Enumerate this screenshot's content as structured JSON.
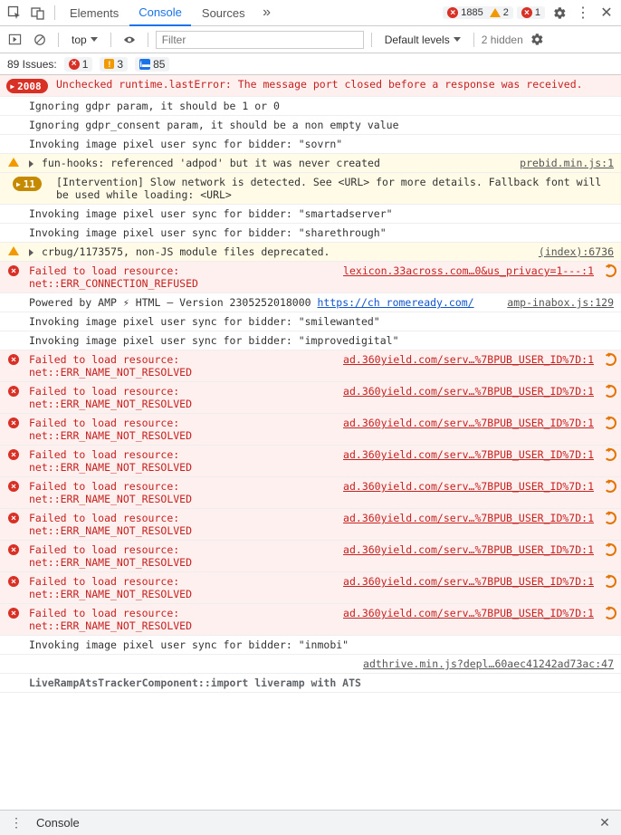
{
  "header": {
    "tabs": [
      "Elements",
      "Console",
      "Sources"
    ],
    "active_tab": 1,
    "error_count": "1885",
    "warn_count": "2",
    "other_err": "1"
  },
  "toolbar": {
    "context": "top",
    "filter_placeholder": "Filter",
    "levels": "Default levels",
    "hidden": "2 hidden"
  },
  "issues": {
    "label": "89 Issues:",
    "red": "1",
    "yellow": "3",
    "blue": "85"
  },
  "rows": [
    {
      "type": "error",
      "badge": "2008",
      "badgeKind": "err",
      "text": "Unchecked runtime.lastError: The message port closed before a response was received.",
      "source": "",
      "reficon": false
    },
    {
      "type": "log",
      "text": "Ignoring gdpr param, it should be 1 or 0"
    },
    {
      "type": "log",
      "text": "Ignoring gdpr_consent param, it should be a non empty value"
    },
    {
      "type": "log",
      "text": "Invoking image pixel user sync for bidder: \"sovrn\""
    },
    {
      "type": "warn",
      "disclose": true,
      "text": "fun-hooks: referenced 'adpod' but it was never created",
      "source": "prebid.min.js:1"
    },
    {
      "type": "warn",
      "badge": "11",
      "badgeKind": "warn",
      "text": "[Intervention] Slow network is detected. See <URL> for more details. Fallback font will be used while loading: <URL>"
    },
    {
      "type": "log",
      "text": "Invoking image pixel user sync for bidder: \"smartadserver\""
    },
    {
      "type": "log",
      "text": "Invoking image pixel user sync for bidder: \"sharethrough\""
    },
    {
      "type": "warn",
      "disclose": true,
      "text": "crbug/1173575, non-JS module files deprecated.",
      "source": "(index):6736"
    },
    {
      "type": "error",
      "icon": "errx",
      "text": "Failed to load resource: net::ERR_CONNECTION_REFUSED",
      "source": "lexicon.33across.com…0&us_privacy=1---:1",
      "reficon": true
    },
    {
      "type": "log",
      "html": true,
      "text": "Powered by AMP ⚡ HTML – Version 2305252018000 ",
      "link1": "https://ch romeready.com/",
      "source": "amp-inabox.js:129"
    },
    {
      "type": "log",
      "text": "Invoking image pixel user sync for bidder: \"smilewanted\""
    },
    {
      "type": "log",
      "text": "Invoking image pixel user sync for bidder: \"improvedigital\""
    },
    {
      "type": "error",
      "icon": "errx",
      "text": "Failed to load resource: net::ERR_NAME_NOT_RESOLVED",
      "source": "ad.360yield.com/serv…%7BPUB_USER_ID%7D:1",
      "reficon": true
    },
    {
      "type": "error",
      "icon": "errx",
      "text": "Failed to load resource: net::ERR_NAME_NOT_RESOLVED",
      "source": "ad.360yield.com/serv…%7BPUB_USER_ID%7D:1",
      "reficon": true
    },
    {
      "type": "error",
      "icon": "errx",
      "text": "Failed to load resource: net::ERR_NAME_NOT_RESOLVED",
      "source": "ad.360yield.com/serv…%7BPUB_USER_ID%7D:1",
      "reficon": true
    },
    {
      "type": "error",
      "icon": "errx",
      "text": "Failed to load resource: net::ERR_NAME_NOT_RESOLVED",
      "source": "ad.360yield.com/serv…%7BPUB_USER_ID%7D:1",
      "reficon": true
    },
    {
      "type": "error",
      "icon": "errx",
      "text": "Failed to load resource: net::ERR_NAME_NOT_RESOLVED",
      "source": "ad.360yield.com/serv…%7BPUB_USER_ID%7D:1",
      "reficon": true
    },
    {
      "type": "error",
      "icon": "errx",
      "text": "Failed to load resource: net::ERR_NAME_NOT_RESOLVED",
      "source": "ad.360yield.com/serv…%7BPUB_USER_ID%7D:1",
      "reficon": true
    },
    {
      "type": "error",
      "icon": "errx",
      "text": "Failed to load resource: net::ERR_NAME_NOT_RESOLVED",
      "source": "ad.360yield.com/serv…%7BPUB_USER_ID%7D:1",
      "reficon": true
    },
    {
      "type": "error",
      "icon": "errx",
      "text": "Failed to load resource: net::ERR_NAME_NOT_RESOLVED",
      "source": "ad.360yield.com/serv…%7BPUB_USER_ID%7D:1",
      "reficon": true
    },
    {
      "type": "error",
      "icon": "errx",
      "text": "Failed to load resource: net::ERR_NAME_NOT_RESOLVED",
      "source": "ad.360yield.com/serv…%7BPUB_USER_ID%7D:1",
      "reficon": true
    },
    {
      "type": "log",
      "text": "Invoking image pixel user sync for bidder: \"inmobi\""
    },
    {
      "type": "log",
      "text": "",
      "source": "adthrive.min.js?depl…60aec41242ad73ac:47"
    },
    {
      "type": "log",
      "bold": true,
      "text": "LiveRampAtsTrackerComponent::import liveramp with ATS"
    }
  ],
  "drawer": {
    "title": "Console"
  }
}
